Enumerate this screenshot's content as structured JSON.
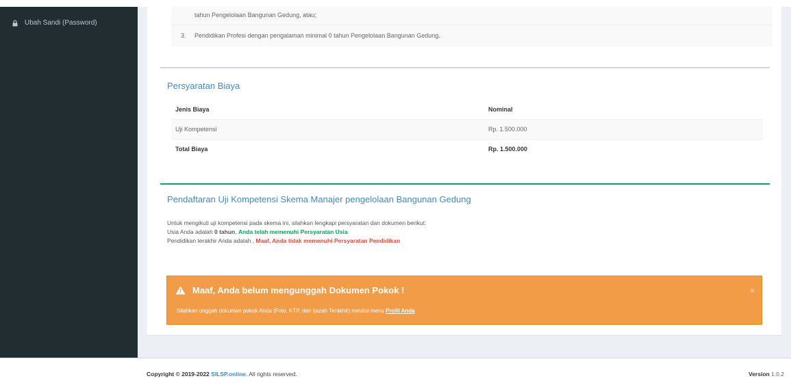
{
  "sidebar": {
    "items": [
      {
        "label": "Ubah Sandi (Password)",
        "icon": "lock-icon"
      }
    ]
  },
  "education": {
    "line1": "tahun Pengelolaan Bangunan Gedung, atau;",
    "item3_number": "3.",
    "item3_text": "Pendidikan Profesi dengan pengalaman minimal 0 tahun Pengelolaan Bangunan Gedung."
  },
  "fees": {
    "title": "Persyaratan Biaya",
    "header": {
      "col1": "Jenis Biaya",
      "col2": "Nominal"
    },
    "rows": [
      {
        "name": "Uji Kompetensi",
        "amount": "Rp. 1.500.000"
      }
    ],
    "total": {
      "label": "Total Biaya",
      "amount": "Rp. 1.500.000"
    }
  },
  "registration": {
    "title": "Pendaftaran Uji Kompetensi Skema Manajer pengelolaan Bangunan Gedung",
    "intro": "Untuk mengikuti uji kompetensi pada skema ini, silahkan lengkapi persyaratan dan dokumen berikut:",
    "age_prefix": "Usia Anda adalah ",
    "age_value": "0 tahun",
    "age_sep": ", ",
    "age_status": "Anda telah memenuhi Persyaratan Usia",
    "edu_prefix": "Pendidikan terakhir Anda adalah , ",
    "edu_status": "Maaf, Anda tidak memenuhi Persyaratan Pendidikan"
  },
  "alert": {
    "title": "Maaf, Anda belum mengunggah Dokumen Pokok !",
    "body": "Silahkan unggah dokumen pokok Anda (Foto, KTP, dan Ijazah Terakhir) melalui menu ",
    "link": "Profil Anda",
    "close": "×",
    "color": "#f39c47"
  },
  "footer": {
    "copyright_label": "Copyright © 2019-2022",
    "brand": "SILSP.online.",
    "rights": " All rights reserved.",
    "version_label": "Version",
    "version_value": " 1.0.2"
  },
  "colors": {
    "sidebar_bg": "#222d32",
    "accent_blue": "#3c8dbc",
    "success_green": "#00a65a",
    "danger_red": "#dd4b39",
    "warning_orange": "#f39c47"
  }
}
